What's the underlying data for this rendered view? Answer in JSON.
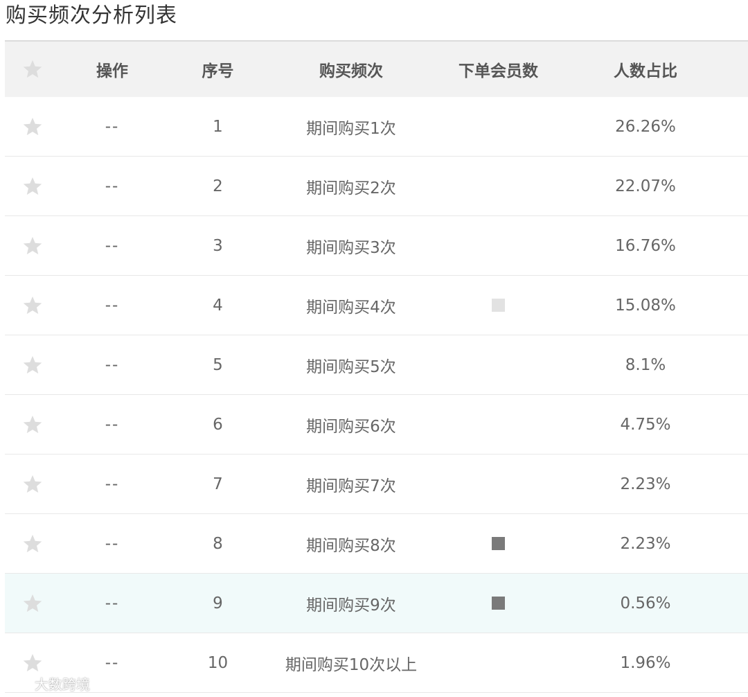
{
  "title": "购买频次分析列表",
  "header": {
    "op": "操作",
    "seq": "序号",
    "freq": "购买频次",
    "members": "下单会员数",
    "pct": "人数占比"
  },
  "rows": [
    {
      "op": "--",
      "seq": "1",
      "freq": "期间购买1次",
      "pct": "26.26%"
    },
    {
      "op": "--",
      "seq": "2",
      "freq": "期间购买2次",
      "pct": "22.07%"
    },
    {
      "op": "--",
      "seq": "3",
      "freq": "期间购买3次",
      "pct": "16.76%"
    },
    {
      "op": "--",
      "seq": "4",
      "freq": "期间购买4次",
      "pct": "15.08%"
    },
    {
      "op": "--",
      "seq": "5",
      "freq": "期间购买5次",
      "pct": "8.1%"
    },
    {
      "op": "--",
      "seq": "6",
      "freq": "期间购买6次",
      "pct": "4.75%"
    },
    {
      "op": "--",
      "seq": "7",
      "freq": "期间购买7次",
      "pct": "2.23%"
    },
    {
      "op": "--",
      "seq": "8",
      "freq": "期间购买8次",
      "pct": "2.23%"
    },
    {
      "op": "--",
      "seq": "9",
      "freq": "期间购买9次",
      "pct": "0.56%"
    },
    {
      "op": "--",
      "seq": "10",
      "freq": "期间购买10次以上",
      "pct": "1.96%"
    }
  ],
  "watermark": "大数跨境",
  "icons": {
    "favorite": "star-icon",
    "logo": "watermark-logo-icon"
  },
  "colors": {
    "header_bg": "#f2f2f2",
    "highlight_row_bg": "#f1fafa",
    "star_gray": "#dddddd",
    "text": "#666666"
  }
}
